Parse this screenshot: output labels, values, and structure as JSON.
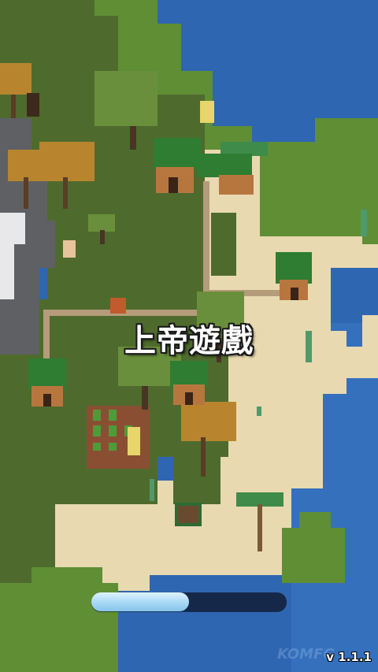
{
  "game": {
    "title": "上帝遊戲",
    "version": "v 1.1.1",
    "loading_progress": 0.5,
    "watermark": "KOMFG"
  },
  "colors": {
    "ocean": "#2f66b1",
    "grass": "#4e6b2d",
    "dark_grass": "#3f5a26",
    "light_grass": "#5f8e35",
    "sand": "#e8d9b0",
    "rock": "#5f6064",
    "snow": "#e8e8ea",
    "progress_fill": "#a7d8f5",
    "progress_track": "#152849"
  }
}
